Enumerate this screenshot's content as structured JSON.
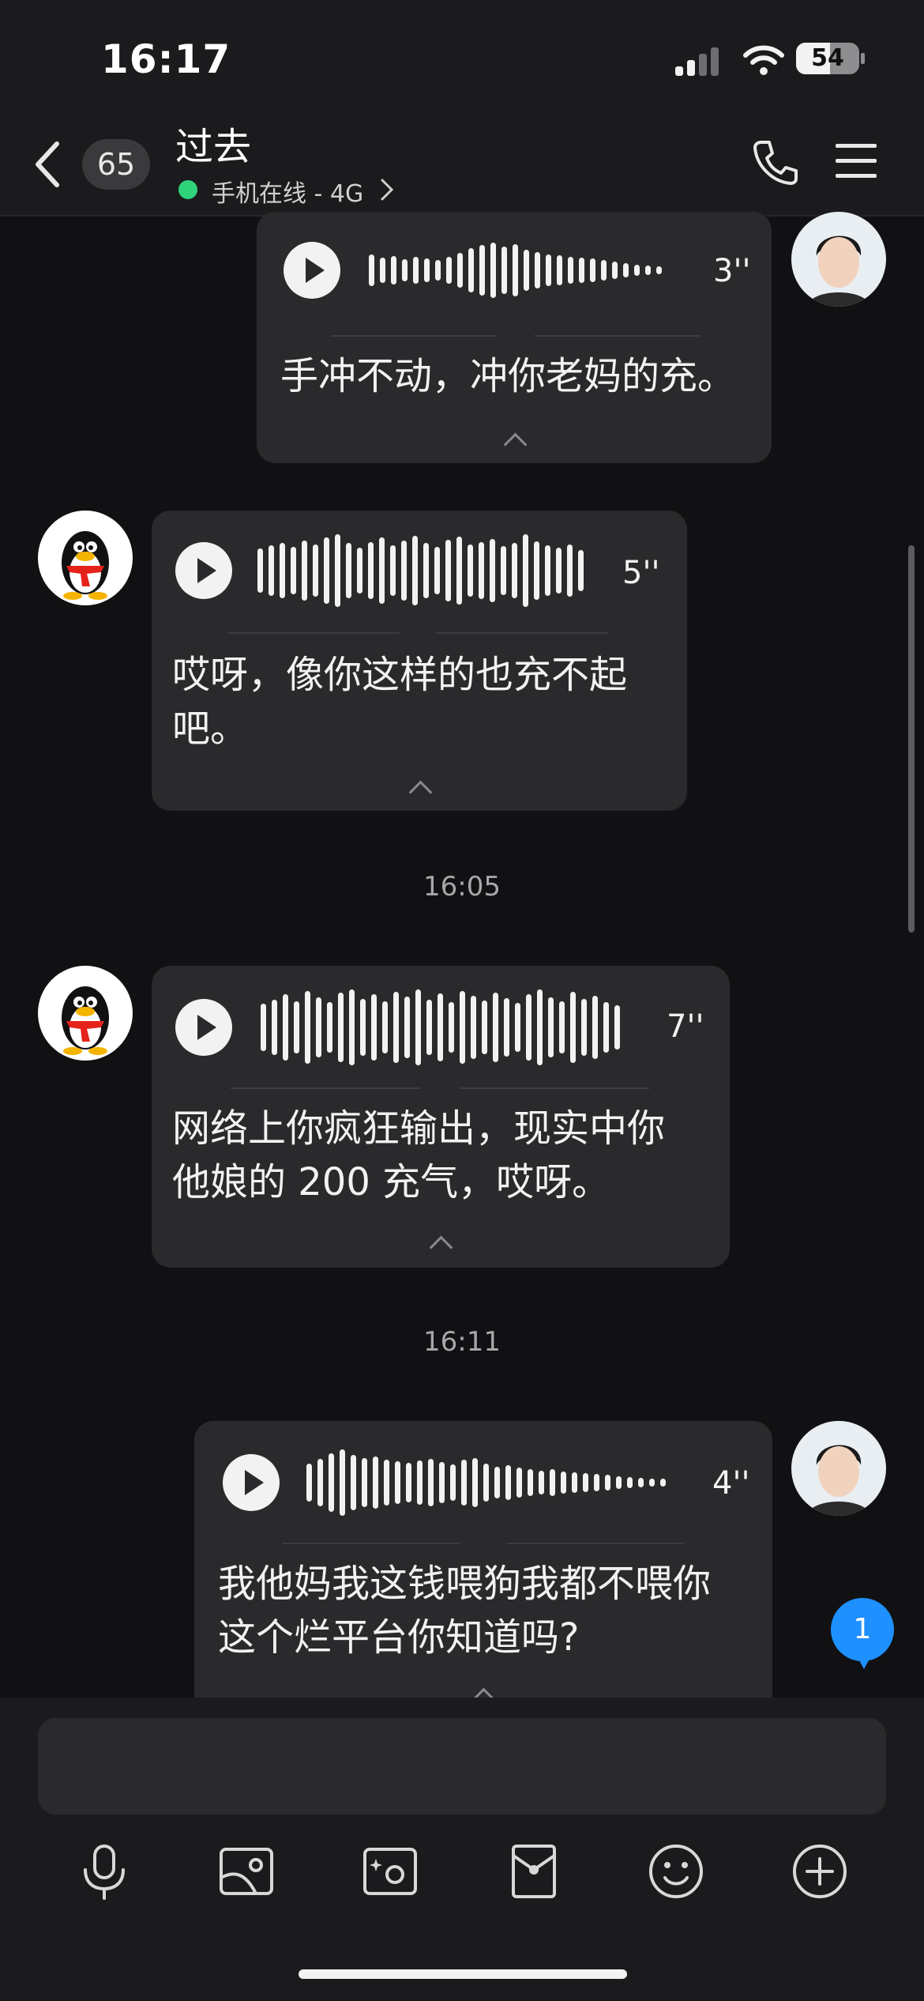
{
  "status": {
    "time": "16:17",
    "battery": "54",
    "battery_level": 0.54
  },
  "header": {
    "unread_count": "65",
    "title": "过去",
    "online_status": "手机在线 - 4G"
  },
  "messages": [
    {
      "side": "right",
      "duration": "3''",
      "text": "手冲不动，冲你老妈的充。"
    },
    {
      "side": "left",
      "duration": "5''",
      "text_line1": "哎呀，像你这样的也充不起",
      "text_line2": "吧。"
    },
    {
      "timestamp": "16:05"
    },
    {
      "side": "left",
      "duration": "7''",
      "text_line1": "网络上你疯狂输出，现实中你",
      "text_line2": "他娘的 200 充气，哎呀。"
    },
    {
      "timestamp": "16:11"
    },
    {
      "side": "right",
      "duration": "4''",
      "text_line1": "我他妈我这钱喂狗我都不喂你",
      "text_line2": "这个烂平台你知道吗?"
    }
  ],
  "new_message_badge": "1",
  "input": {
    "value": ""
  },
  "toolbar": {
    "icons": [
      "microphone-icon",
      "image-icon",
      "camera-icon",
      "red-packet-icon",
      "emoji-icon",
      "plus-icon"
    ]
  },
  "colors": {
    "background": "#111113",
    "bubble": "#2a2a2c",
    "online": "#2fd47a",
    "badge": "#1e90ff"
  }
}
